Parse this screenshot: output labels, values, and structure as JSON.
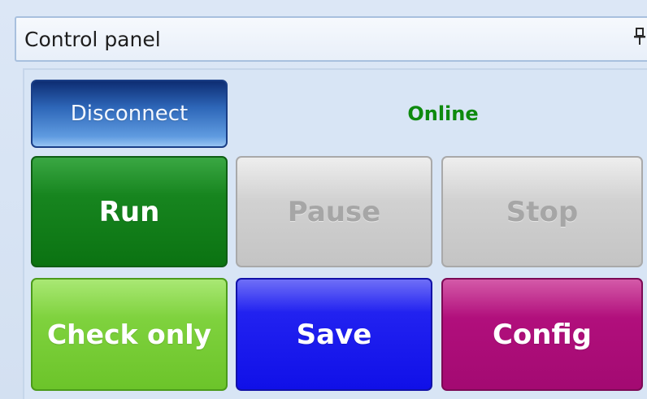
{
  "panel": {
    "title": "Control panel",
    "pin_icon": "pin-icon"
  },
  "connection": {
    "disconnect_label": "Disconnect",
    "status": "Online",
    "status_color": "#0e8a0e"
  },
  "buttons": {
    "run": {
      "label": "Run",
      "color": "#0b7312",
      "enabled": true
    },
    "pause": {
      "label": "Pause",
      "color": "#c4c4c4",
      "enabled": false
    },
    "stop": {
      "label": "Stop",
      "color": "#c4c4c4",
      "enabled": false
    },
    "check_only": {
      "label": "Check only",
      "color": "#6cc42a",
      "enabled": true
    },
    "save": {
      "label": "Save",
      "color": "#1010e8",
      "enabled": true
    },
    "config": {
      "label": "Config",
      "color": "#a30a72",
      "enabled": true
    }
  }
}
